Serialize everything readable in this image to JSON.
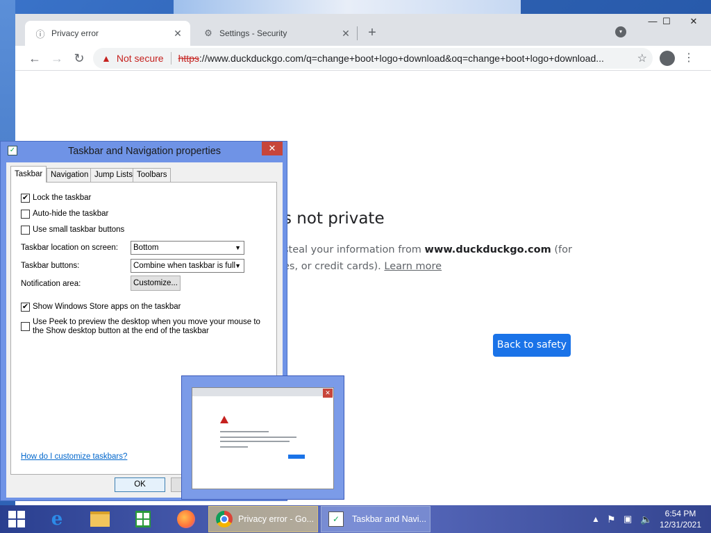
{
  "browser": {
    "tabs": [
      {
        "label": "Privacy error",
        "icon": "info-icon",
        "active": true
      },
      {
        "label": "Settings - Security",
        "icon": "gear-icon",
        "active": false
      }
    ],
    "window_controls": {
      "minimize": "—",
      "maximize": "☐",
      "close": "✕"
    },
    "address": {
      "security_label": "Not secure",
      "scheme": "https",
      "url_rest": "://www.duckduckgo.com/q=change+boot+logo+download&oq=change+boot+logo+download..."
    },
    "page": {
      "heading": "s not private",
      "line1_prefix": "steal your information from ",
      "line1_domain": "www.duckduckgo.com",
      "line1_suffix": " (for",
      "line2_prefix": "es, or credit cards). ",
      "learn_more": "Learn more",
      "back_button": "Back to safety"
    }
  },
  "dialog": {
    "title": "Taskbar and Navigation properties",
    "tabs": [
      "Taskbar",
      "Navigation",
      "Jump Lists",
      "Toolbars"
    ],
    "checkboxes": [
      {
        "label": "Lock the taskbar",
        "checked": true
      },
      {
        "label": "Auto-hide the taskbar",
        "checked": false
      },
      {
        "label": "Use small taskbar buttons",
        "checked": false
      },
      {
        "label": "Show Windows Store apps on the taskbar",
        "checked": true
      },
      {
        "label": "Use Peek to preview the desktop when you move your mouse to the Show desktop button at the end of the taskbar",
        "checked": false
      }
    ],
    "location_label": "Taskbar location on screen:",
    "location_value": "Bottom",
    "buttons_label": "Taskbar buttons:",
    "buttons_value": "Combine when taskbar is full",
    "notification_label": "Notification area:",
    "customize_button": "Customize...",
    "help_link": "How do I customize taskbars?",
    "ok_button": "OK"
  },
  "taskbar": {
    "tasks": [
      {
        "label": "Privacy error - Go...",
        "icon": "chrome-icon"
      },
      {
        "label": "Taskbar and Navi...",
        "icon": "properties-icon"
      }
    ],
    "clock": {
      "time": "6:54 PM",
      "date": "12/31/2021"
    }
  },
  "colors": {
    "accent": "#1a73e8",
    "danger": "#c5221f",
    "dialog_frame": "#6f93e6"
  }
}
